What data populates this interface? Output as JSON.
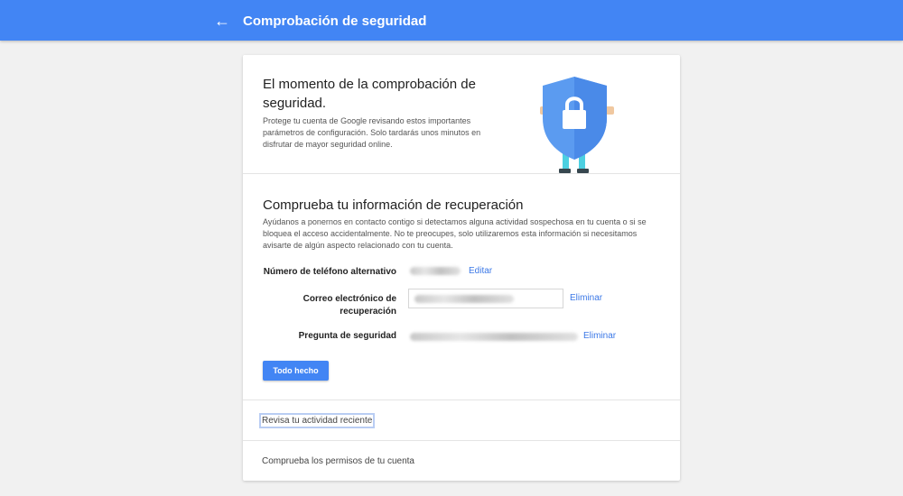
{
  "header": {
    "title": "Comprobación de seguridad",
    "back_icon": "←"
  },
  "intro": {
    "title": "El momento de la comprobación de seguridad.",
    "description": "Protege tu cuenta de Google revisando estos importantes parámetros de configuración. Solo tardarás unos minutos en disfrutar de mayor seguridad online."
  },
  "recovery": {
    "title": "Comprueba tu información de recuperación",
    "description": "Ayúdanos a ponernos en contacto contigo si detectamos alguna actividad sospechosa en tu cuenta o si se bloquea el acceso accidentalmente. No te preocupes, solo utilizaremos esta información si necesitamos avisarte de algún aspecto relacionado con tu cuenta.",
    "phone_label": "Número de teléfono alternativo",
    "phone_action": "Editar",
    "email_label": "Correo electrónico de recuperación",
    "email_action": "Eliminar",
    "question_label": "Pregunta de seguridad",
    "question_action": "Eliminar",
    "done_button": "Todo hecho"
  },
  "sections": {
    "activity": "Revisa tu actividad reciente",
    "permissions": "Comprueba los permisos de tu cuenta"
  },
  "colors": {
    "brand_blue": "#4285f4",
    "link_blue": "#3b78e7",
    "shield_blue": "#5b9bf0"
  }
}
